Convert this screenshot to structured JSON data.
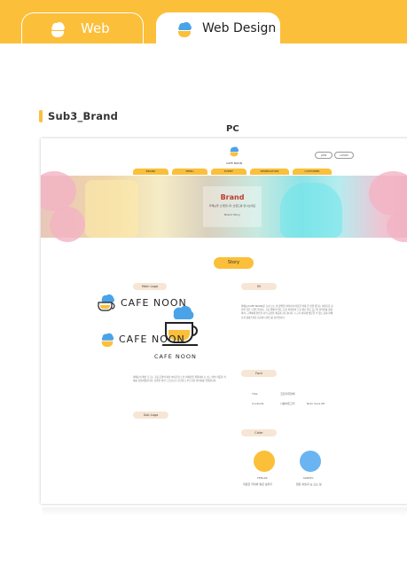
{
  "tabs": [
    {
      "label": "Web",
      "active": false
    },
    {
      "label": "Web Design",
      "active": true
    }
  ],
  "section_title": "Sub3_Brand",
  "device_label": "PC",
  "mockup": {
    "logo_text": "CAFE NOON",
    "login": [
      "JOIN",
      "LOGIN"
    ],
    "nav": [
      "BRAND",
      "MENU",
      "EVENT",
      "RESERVATION",
      "CUSTOMER"
    ],
    "hero_title": "Brand",
    "hero_sub": "카페눈을 소개합니다 브랜드를 만나보세요",
    "hero_sub2": "Brand Story",
    "story_label": "Story",
    "main_logo_label": "Main Logo",
    "bi_label": "BI",
    "bi_text": "카페눈(CAFE NOON)은 눈이 오는 날 창밖을 바라보며 따뜻한 커피 한 잔을 즐기는 여유로운 순간을 담은 브랜드입니다. 구름 위에 떠 있는 듯한 커피잔과 노란 컵은 밝고 포근한 분위기를 상징하며, 고객에게 편안한 휴식 공간을 제공하고자 합니다. 누구나 편하게 방문할 수 있는 동네 카페로서 정성스러운 음료와 디저트를 선보입니다.",
    "logo_desc": "카페눈의 메인 로고는 구름 모양의 파란 아이콘과 노란 커피잔을 결합하여 눈 오는 날의 따뜻한 커피를 표현하였습니다. 심플한 라인 드로잉으로 친근하고 부드러운 이미지를 전달합니다.",
    "font_label": "Font",
    "font_rows": [
      {
        "k": "Title",
        "v": "코트라희망체"
      },
      {
        "k": "Contents",
        "v": "나눔바른고딕",
        "v2": "Noto Sans KR"
      }
    ],
    "sub_logo_label": "Sub Logo",
    "color_label": "Color",
    "colors": [
      {
        "hex": "#fbbf3a",
        "name": "FFBC2B",
        "desc": "따뜻한 커피와 밝은 분위기"
      },
      {
        "hex": "#6ab4f2",
        "name": "60B0F0",
        "desc": "맑은 하늘과 눈 오는 날"
      }
    ],
    "sub_logo_text": "CAFE NOON"
  },
  "colors": {
    "accent": "#fbbf3a",
    "cloud": "#4aa3e8"
  }
}
